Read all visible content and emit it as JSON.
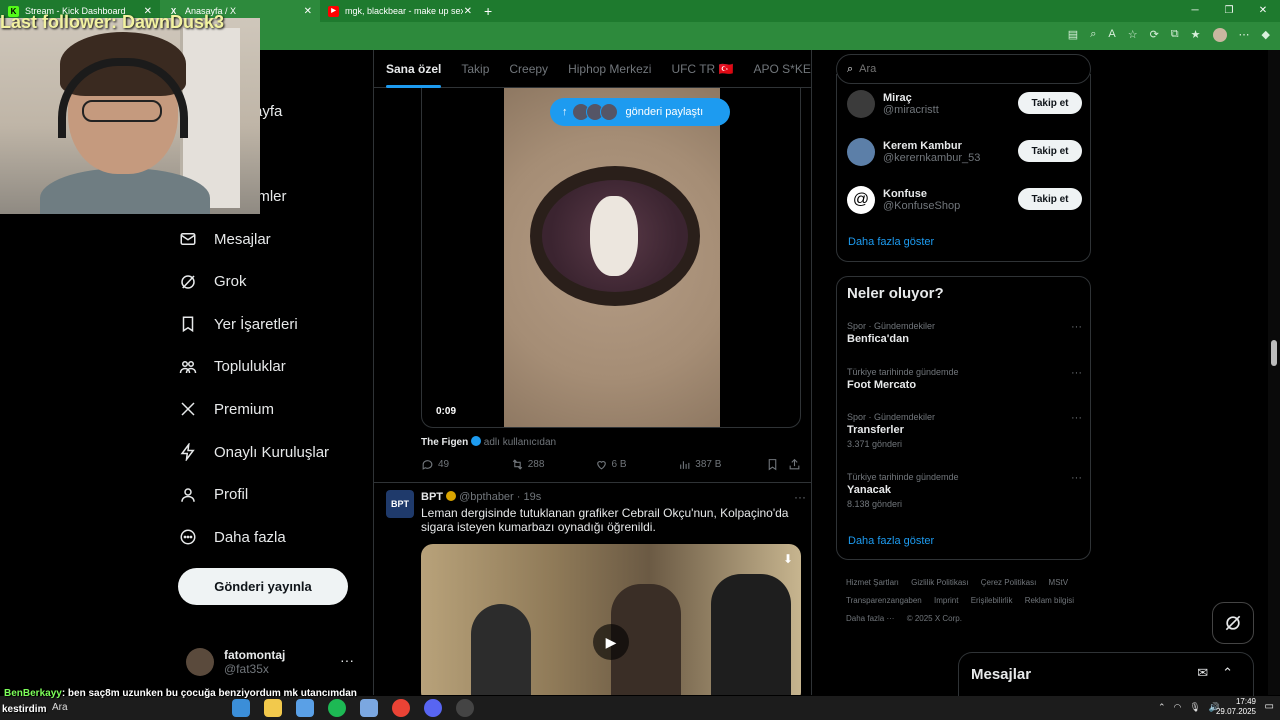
{
  "browser": {
    "tabs": [
      {
        "label": "Stream - Kick Dashboard",
        "icon": "kick-icon"
      },
      {
        "label": "Anasayfa / X",
        "icon": "x-logo-icon"
      },
      {
        "label": "mgk, blackbear - make up sex ft.",
        "icon": "youtube-icon"
      }
    ]
  },
  "overlay": {
    "follower_text": "Last follower: DawnDusk3",
    "chat_user": "BenBerkayy",
    "chat_message": ": ben saç8m uzunken bu çocuğa benziyordum mk utancımdan",
    "chat_continuation": "kestirdim"
  },
  "nav": {
    "partial_items": [
      "ayfa",
      "t",
      "imler"
    ],
    "items": [
      {
        "label": "Mesajlar",
        "icon": "mail-icon"
      },
      {
        "label": "Grok",
        "icon": "grok-icon"
      },
      {
        "label": "Yer İşaretleri",
        "icon": "bookmark-icon"
      },
      {
        "label": "Topluluklar",
        "icon": "communities-icon"
      },
      {
        "label": "Premium",
        "icon": "x-logo-icon"
      },
      {
        "label": "Onaylı Kuruluşlar",
        "icon": "lightning-icon"
      },
      {
        "label": "Profil",
        "icon": "profile-icon"
      },
      {
        "label": "Daha fazla",
        "icon": "more-circle-icon"
      }
    ],
    "post_button": "Gönderi yayınla",
    "account": {
      "name": "fatomontaj",
      "handle": "@fat35x"
    }
  },
  "feed": {
    "tabs": [
      "Sana özel",
      "Takip",
      "Creepy",
      "Hiphop Merkezi",
      "UFC TR 🇹🇷",
      "APO S*KEN"
    ],
    "share_pill": "gönderi paylaştı",
    "video_time": "0:09",
    "credit_name": "The Figen",
    "credit_suffix": "adlı kullanıcıdan",
    "stats": {
      "replies": "49",
      "reposts": "288",
      "likes": "6 B",
      "views": "387 B"
    },
    "tweet2": {
      "name": "BPT",
      "handle": "@bpthaber",
      "time": "· 19s",
      "avatar_text": "BPT",
      "text": "Leman dergisinde tutuklanan grafiker Cebrail Okçu'nun, Kolpaçino'da sigara isteyen kumarbazı oynadığı öğrenildi."
    }
  },
  "right": {
    "search_placeholder": "Ara",
    "who_to_follow": [
      {
        "name": "Miraç",
        "handle": "@miracristt"
      },
      {
        "name": "Kerem Kambur",
        "handle": "@kerernkambur_53"
      },
      {
        "name": "Konfuse",
        "handle": "@KonfuseShop"
      }
    ],
    "follow_label": "Takip et",
    "show_more": "Daha fazla göster",
    "trends_title": "Neler oluyor?",
    "trends": [
      {
        "context": "Spor · Gündemdekiler",
        "title": "Benfica'dan",
        "count": ""
      },
      {
        "context": "Türkiye tarihinde gündemde",
        "title": "Foot Mercato",
        "count": ""
      },
      {
        "context": "Spor · Gündemdekiler",
        "title": "Transferler",
        "count": "3.371 gönderi"
      },
      {
        "context": "Türkiye tarihinde gündemde",
        "title": "Yanacak",
        "count": "8.138 gönderi"
      }
    ],
    "footer": [
      "Hizmet Şartları",
      "Gizlilik Politikası",
      "Çerez Politikası",
      "MStV Transparenzangaben",
      "Imprint",
      "Erişilebilirlik",
      "Reklam bilgisi",
      "Daha fazla ···",
      "© 2025 X Corp."
    ],
    "messages_drawer": "Mesajlar"
  },
  "taskbar": {
    "search": "Ara",
    "time": "17:49",
    "date": "29.07.2025"
  },
  "colors": {
    "accent": "#1d9bf0",
    "browser_green": "#2d8a3c",
    "background": "#000000"
  }
}
